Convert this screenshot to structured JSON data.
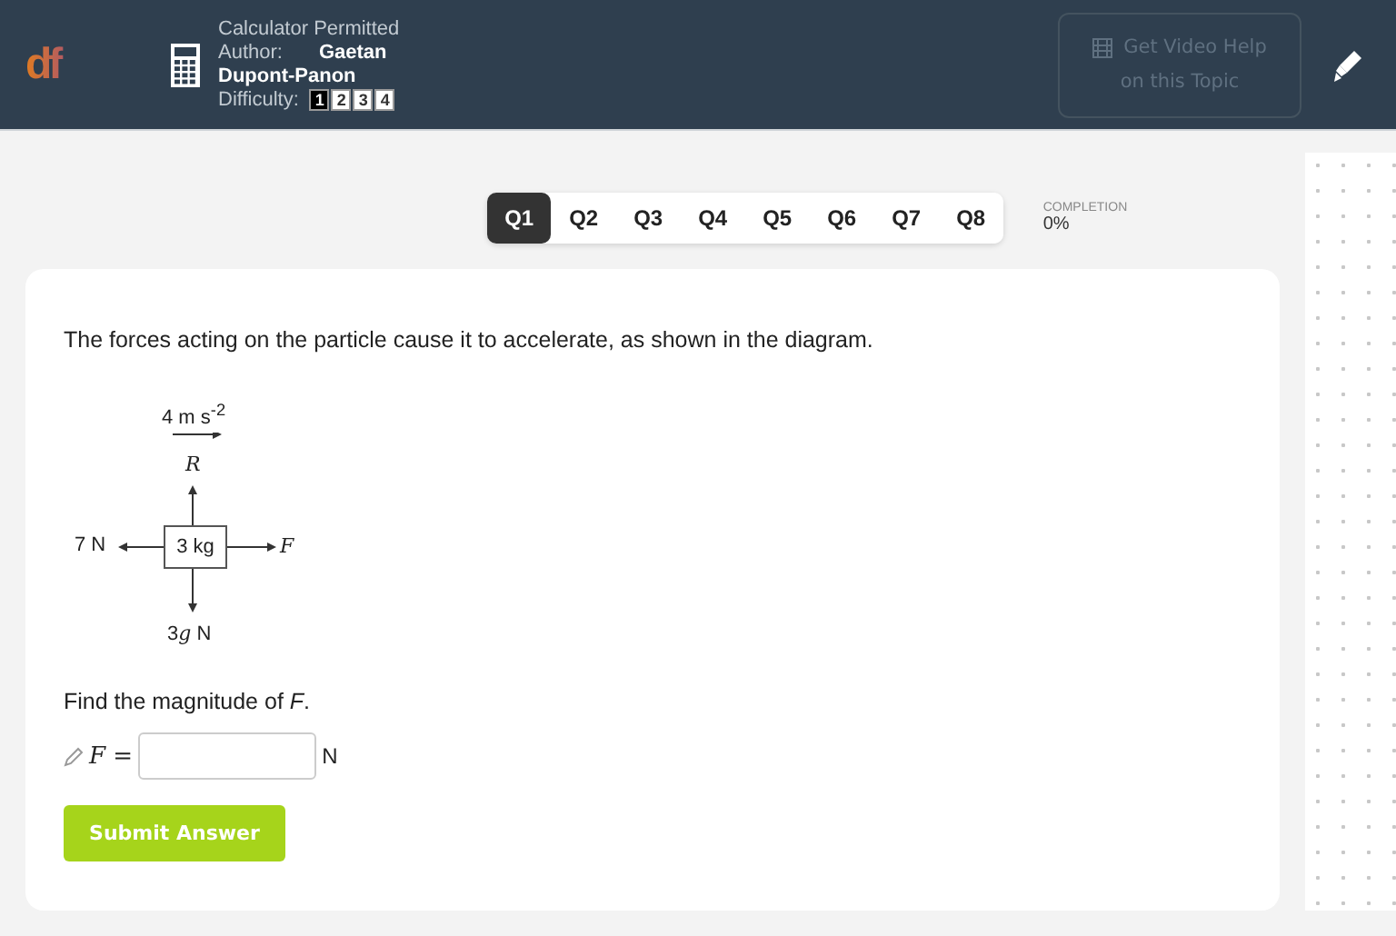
{
  "header": {
    "logo": "df",
    "calculator": "Calculator Permitted",
    "author_label": "Author:",
    "author_name": "Gaetan",
    "author_surname": "Dupont-Panon",
    "difficulty_label": "Difficulty:",
    "difficulty": [
      {
        "label": "1",
        "selected": true
      },
      {
        "label": "2",
        "selected": false
      },
      {
        "label": "3",
        "selected": false
      },
      {
        "label": "4",
        "selected": false
      }
    ],
    "video_help": [
      "Get Video Help",
      "on this Topic"
    ]
  },
  "questions": [
    {
      "label": "Q1",
      "selected": true
    },
    {
      "label": "Q2",
      "selected": false
    },
    {
      "label": "Q3",
      "selected": false
    },
    {
      "label": "Q4",
      "selected": false
    },
    {
      "label": "Q5",
      "selected": false
    },
    {
      "label": "Q6",
      "selected": false
    },
    {
      "label": "Q7",
      "selected": false
    },
    {
      "label": "Q8",
      "selected": false
    }
  ],
  "completion": {
    "label": "COMPLETION",
    "value": "0%"
  },
  "question": {
    "text": "The forces acting on the particle cause it to accelerate, as shown in the diagram.",
    "diagram": {
      "acceleration": "4 m s$^{-2}$",
      "up": "R",
      "left": "7 N",
      "mass": "3 kg",
      "right": "F",
      "down": [
        "3",
        "g",
        "N"
      ]
    },
    "prompt": "Find the magnitude of *F*.",
    "answer_label": "*F* =",
    "unit": "N",
    "submit": "Submit Answer"
  }
}
